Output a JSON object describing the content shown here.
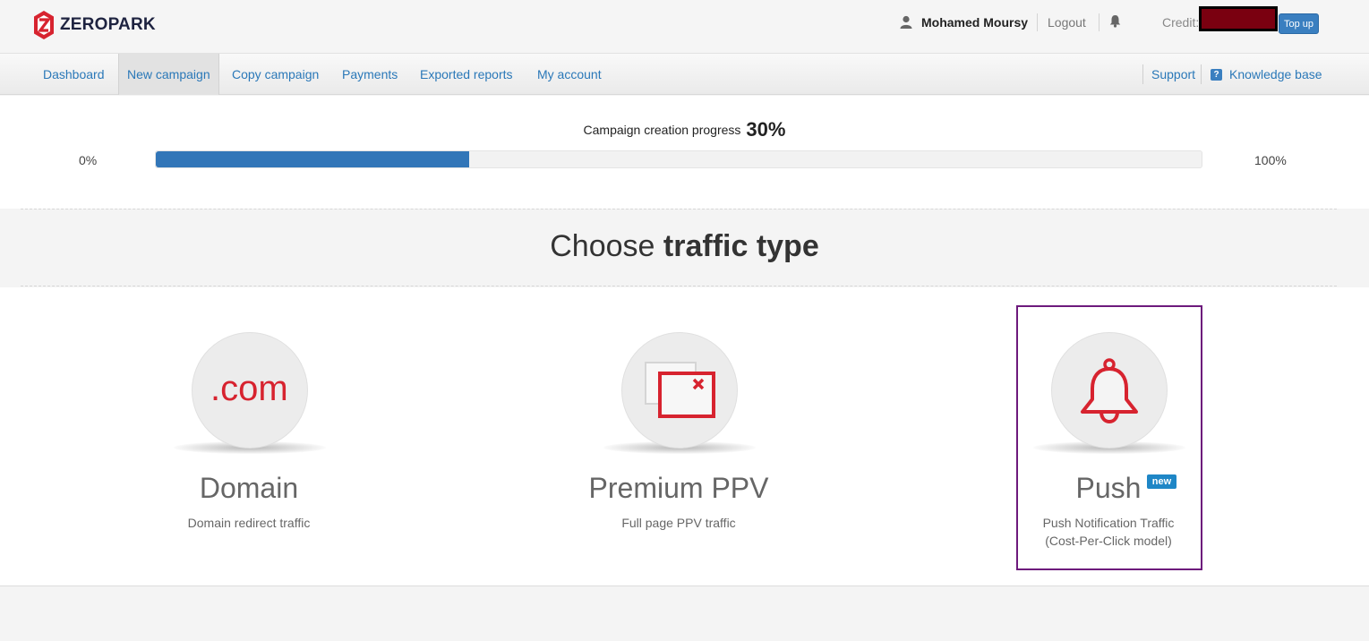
{
  "header": {
    "logo_text": "ZEROPARK",
    "username": "Mohamed Moursy",
    "logout_label": "Logout",
    "credit_label": "Credit:",
    "topup_label": "Top up"
  },
  "nav": {
    "items": [
      {
        "label": "Dashboard"
      },
      {
        "label": "New campaign"
      },
      {
        "label": "Copy campaign"
      },
      {
        "label": "Payments"
      },
      {
        "label": "Exported reports"
      },
      {
        "label": "My account"
      }
    ],
    "support_label": "Support",
    "knowledge_base_label": "Knowledge base",
    "active_item": "New campaign"
  },
  "progress": {
    "label": "Campaign creation progress",
    "percent_text": "30%",
    "percent_value": 30,
    "start_label": "0%",
    "end_label": "100%"
  },
  "heading": {
    "prefix": "Choose",
    "bold": "traffic type"
  },
  "traffic_types": [
    {
      "title": "Domain",
      "icon_text": ".com",
      "icon": "com-icon",
      "description": "Domain redirect traffic"
    },
    {
      "title": "Premium PPV",
      "icon": "popup-window-icon",
      "description": "Full page PPV traffic"
    },
    {
      "title": "Push",
      "icon": "bell-icon",
      "badge": "new",
      "description_line1": "Push Notification Traffic",
      "description_line2": "(Cost-Per-Click model)",
      "selected": true
    }
  ],
  "colors": {
    "brand_red": "#d7232f",
    "link_blue": "#2a78b8",
    "progress_blue": "#3276b8",
    "badge_blue": "#1e86c6",
    "selection_purple": "#6d1a7c"
  }
}
